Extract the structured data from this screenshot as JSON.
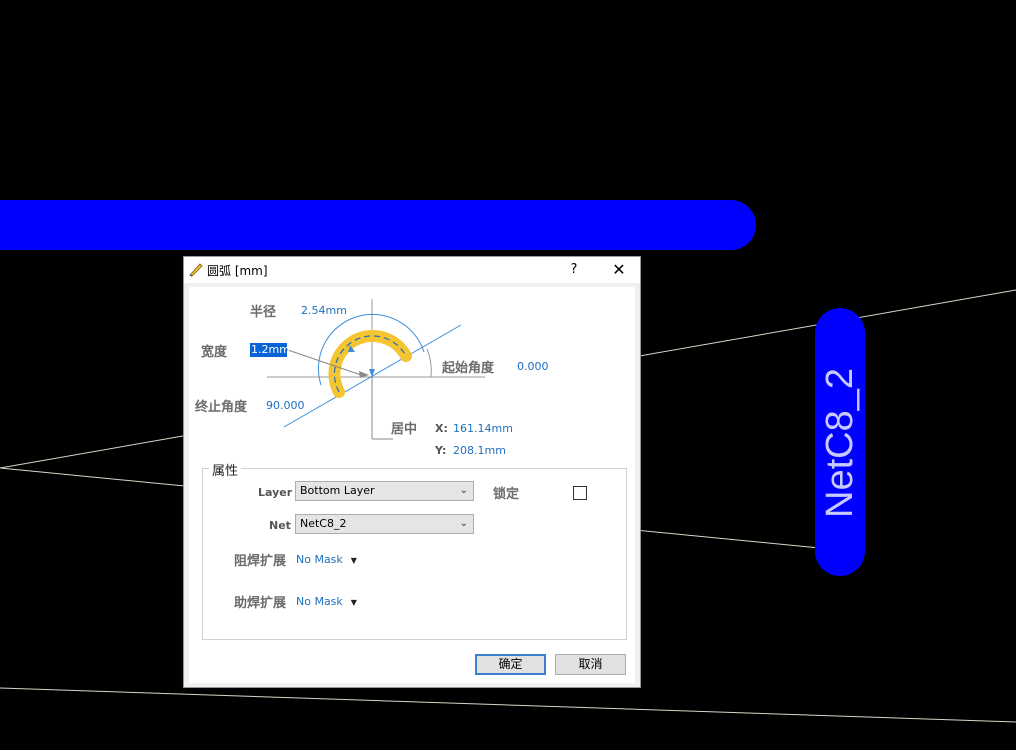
{
  "canvas": {
    "net_label": "NetC8_2",
    "trace_color": "#0000ff",
    "background": "#000000"
  },
  "dialog": {
    "title": "圆弧 [mm]",
    "help": "?",
    "close": "✕",
    "radius_label": "半径",
    "radius_value": "2.54mm",
    "width_label": "宽度",
    "width_value": "1.2mm",
    "start_angle_label": "起始角度",
    "start_angle_value": "0.000",
    "end_angle_label": "终止角度",
    "end_angle_value": "90.000",
    "center_label": "居中",
    "x_label": "X:",
    "x_value": "161.14mm",
    "y_label": "Y:",
    "y_value": "208.1mm",
    "properties_title": "属性",
    "layer_label": "Layer",
    "layer_value": "Bottom Layer",
    "lock_label": "锁定",
    "net_label": "Net",
    "net_value": "NetC8_2",
    "solder_mask_label": "阻焊扩展",
    "solder_mask_value": "No Mask",
    "paste_mask_label": "助焊扩展",
    "paste_mask_value": "No Mask",
    "ok_label": "确定",
    "cancel_label": "取消",
    "accent_color": "#1f6fbf",
    "arc_color": "#f5c431"
  }
}
